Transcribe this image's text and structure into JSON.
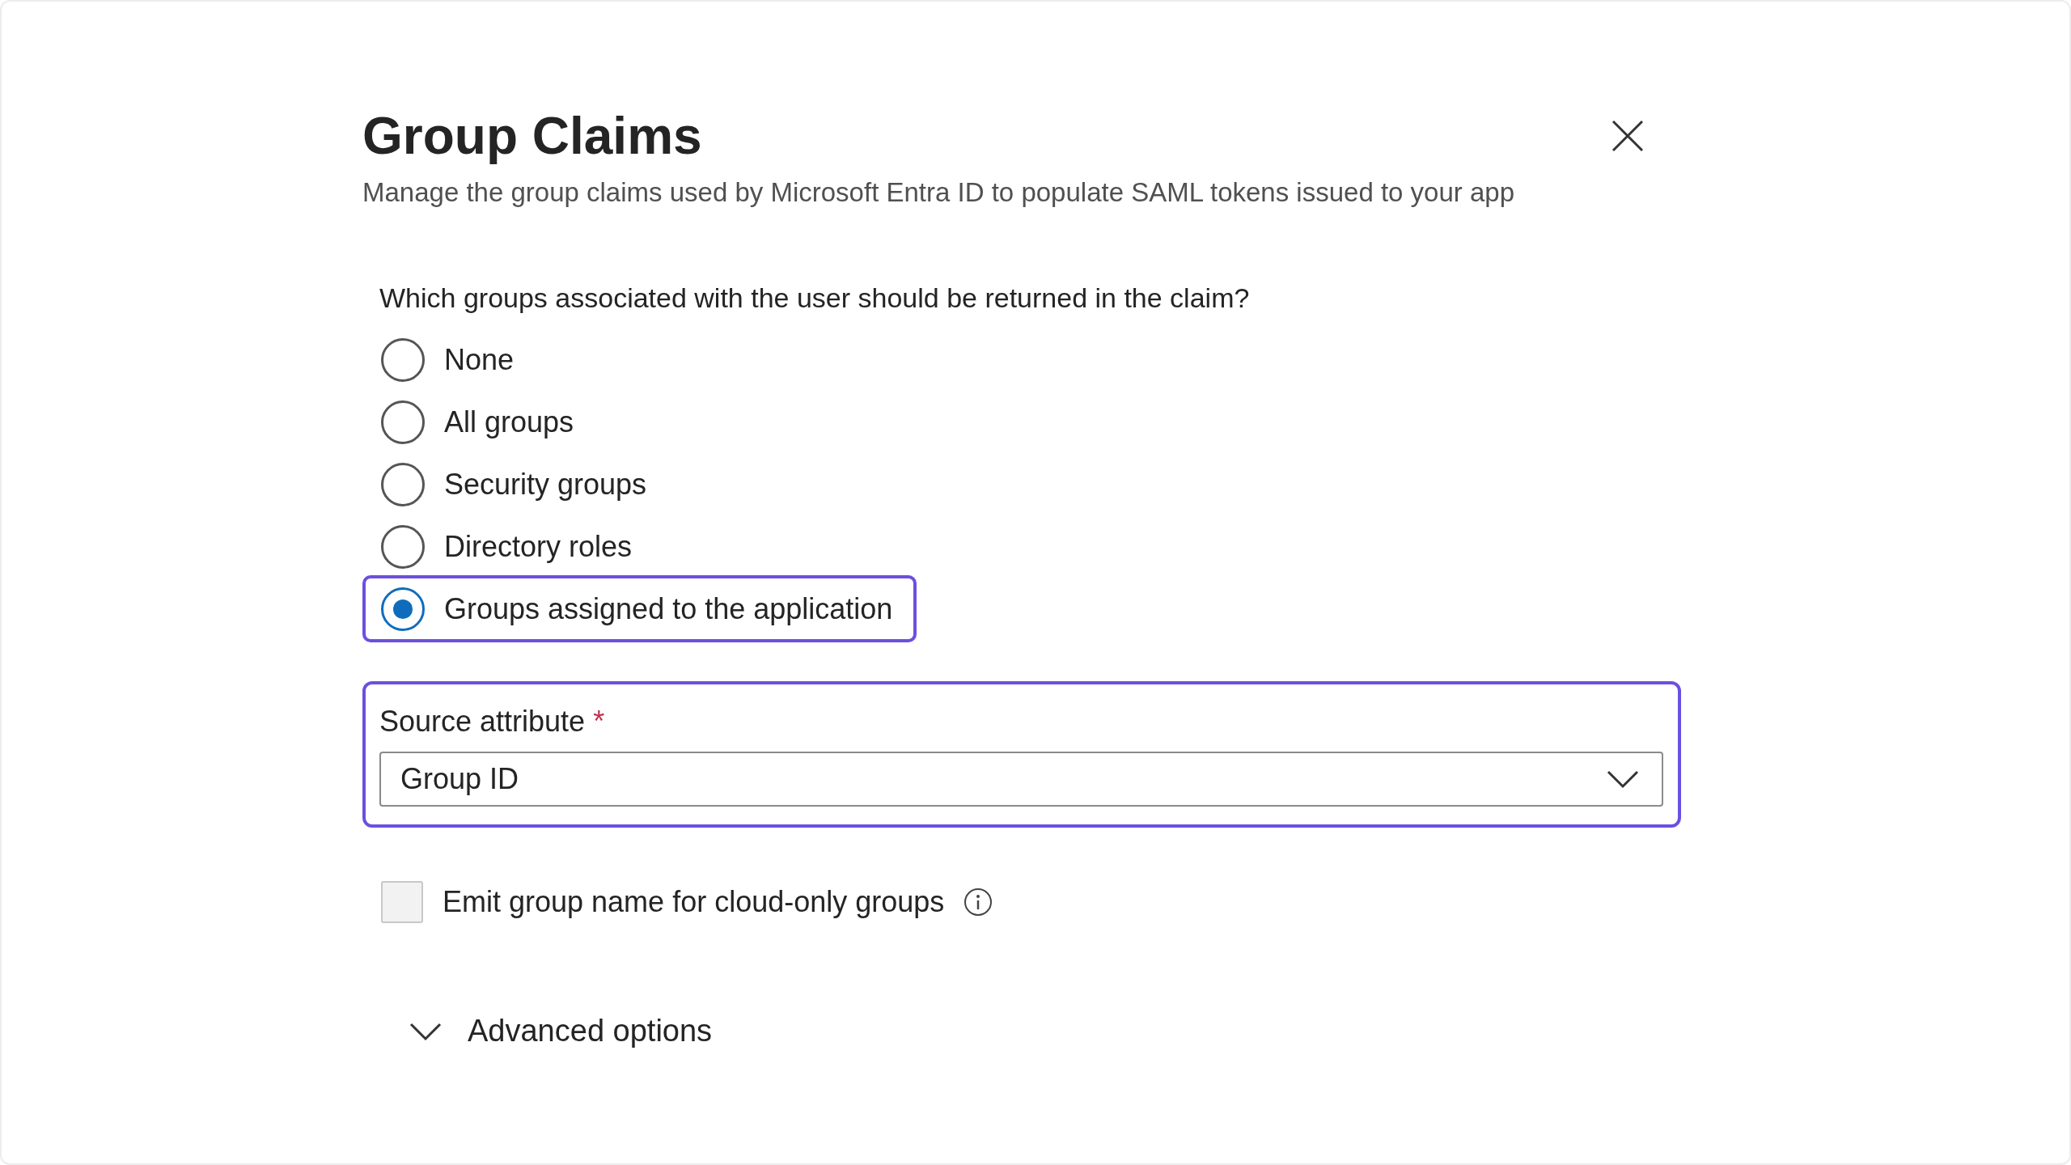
{
  "title": "Group Claims",
  "subtitle": "Manage the group claims used by Microsoft Entra ID to populate SAML tokens issued to your app",
  "question": "Which groups associated with the user should be returned in the claim?",
  "options": [
    {
      "label": "None",
      "selected": false,
      "highlighted": false
    },
    {
      "label": "All groups",
      "selected": false,
      "highlighted": false
    },
    {
      "label": "Security groups",
      "selected": false,
      "highlighted": false
    },
    {
      "label": "Directory roles",
      "selected": false,
      "highlighted": false
    },
    {
      "label": "Groups assigned to the application",
      "selected": true,
      "highlighted": true
    }
  ],
  "source_attribute": {
    "label": "Source attribute",
    "required_mark": "*",
    "value": "Group ID",
    "highlighted": true
  },
  "emit_checkbox": {
    "label": "Emit group name for cloud-only groups",
    "checked": false
  },
  "advanced": {
    "label": "Advanced options",
    "expanded": false
  }
}
